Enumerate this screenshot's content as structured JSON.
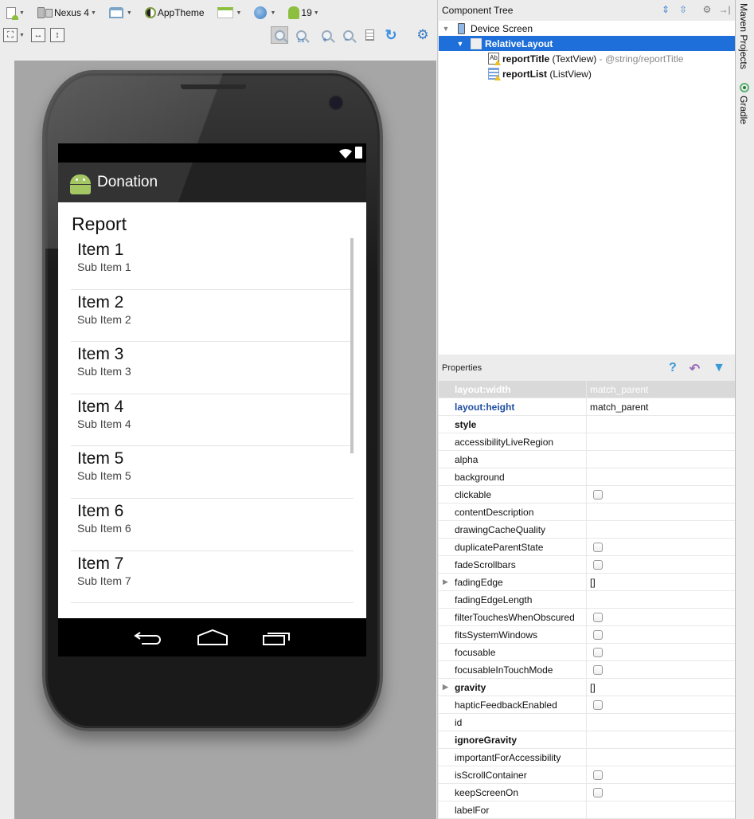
{
  "toolbar": {
    "device": "Nexus 4",
    "theme": "AppTheme",
    "api_level": "19",
    "icons_row1": [
      "new-config-icon",
      "device-icon",
      "orientation-icon",
      "theme-icon",
      "activity-layout-icon",
      "locale-icon",
      "android-api-icon"
    ],
    "icons_row2": [
      "zoom-fit-icon",
      "fit-width-icon",
      "fit-height-icon"
    ],
    "zoom_icons": [
      "zoom-to-fit-icon",
      "zoom-actual-icon",
      "zoom-in-icon",
      "zoom-out-icon",
      "preview-icon",
      "refresh-icon",
      "settings-icon"
    ]
  },
  "device_preview": {
    "app_title": "Donation",
    "report_title": "Report",
    "items": [
      {
        "title": "Item 1",
        "subtitle": "Sub Item 1"
      },
      {
        "title": "Item 2",
        "subtitle": "Sub Item 2"
      },
      {
        "title": "Item 3",
        "subtitle": "Sub Item 3"
      },
      {
        "title": "Item 4",
        "subtitle": "Sub Item 4"
      },
      {
        "title": "Item 5",
        "subtitle": "Sub Item 5"
      },
      {
        "title": "Item 6",
        "subtitle": "Sub Item 6"
      },
      {
        "title": "Item 7",
        "subtitle": "Sub Item 7"
      }
    ]
  },
  "component_tree": {
    "title": "Component Tree",
    "nodes": [
      {
        "name": "Device Screen",
        "type": "",
        "extra": ""
      },
      {
        "name": "RelativeLayout",
        "type": "",
        "extra": "",
        "selected": true
      },
      {
        "name": "reportTitle",
        "type": "(TextView)",
        "extra": "- @string/reportTitle"
      },
      {
        "name": "reportList",
        "type": "(ListView)",
        "extra": ""
      }
    ]
  },
  "properties": {
    "title": "Properties",
    "rows": [
      {
        "name": "layout:width",
        "value": "match_parent",
        "kind": "text",
        "style": "highlight"
      },
      {
        "name": "layout:height",
        "value": "match_parent",
        "kind": "text",
        "style": "blue"
      },
      {
        "name": "style",
        "value": "",
        "kind": "text",
        "style": "bold"
      },
      {
        "name": "accessibilityLiveRegion",
        "value": "",
        "kind": "text"
      },
      {
        "name": "alpha",
        "value": "",
        "kind": "text"
      },
      {
        "name": "background",
        "value": "",
        "kind": "text"
      },
      {
        "name": "clickable",
        "value": "false",
        "kind": "checkbox"
      },
      {
        "name": "contentDescription",
        "value": "",
        "kind": "text"
      },
      {
        "name": "drawingCacheQuality",
        "value": "",
        "kind": "text"
      },
      {
        "name": "duplicateParentState",
        "value": "false",
        "kind": "checkbox"
      },
      {
        "name": "fadeScrollbars",
        "value": "false",
        "kind": "checkbox"
      },
      {
        "name": "fadingEdge",
        "value": "[]",
        "kind": "text",
        "expandable": true
      },
      {
        "name": "fadingEdgeLength",
        "value": "",
        "kind": "text"
      },
      {
        "name": "filterTouchesWhenObscured",
        "value": "false",
        "kind": "checkbox"
      },
      {
        "name": "fitsSystemWindows",
        "value": "false",
        "kind": "checkbox"
      },
      {
        "name": "focusable",
        "value": "false",
        "kind": "checkbox"
      },
      {
        "name": "focusableInTouchMode",
        "value": "false",
        "kind": "checkbox"
      },
      {
        "name": "gravity",
        "value": "[]",
        "kind": "text",
        "expandable": true,
        "style": "bold"
      },
      {
        "name": "hapticFeedbackEnabled",
        "value": "false",
        "kind": "checkbox"
      },
      {
        "name": "id",
        "value": "",
        "kind": "text"
      },
      {
        "name": "ignoreGravity",
        "value": "",
        "kind": "text",
        "style": "bold"
      },
      {
        "name": "importantForAccessibility",
        "value": "",
        "kind": "text"
      },
      {
        "name": "isScrollContainer",
        "value": "false",
        "kind": "checkbox"
      },
      {
        "name": "keepScreenOn",
        "value": "false",
        "kind": "checkbox"
      },
      {
        "name": "labelFor",
        "value": "",
        "kind": "text"
      }
    ]
  },
  "side_tabs": [
    "Maven Projects",
    "Gradle"
  ],
  "colors": {
    "selection": "#1e6fd9",
    "android_green": "#a4c764",
    "property_blue": "#1f4ea0"
  }
}
